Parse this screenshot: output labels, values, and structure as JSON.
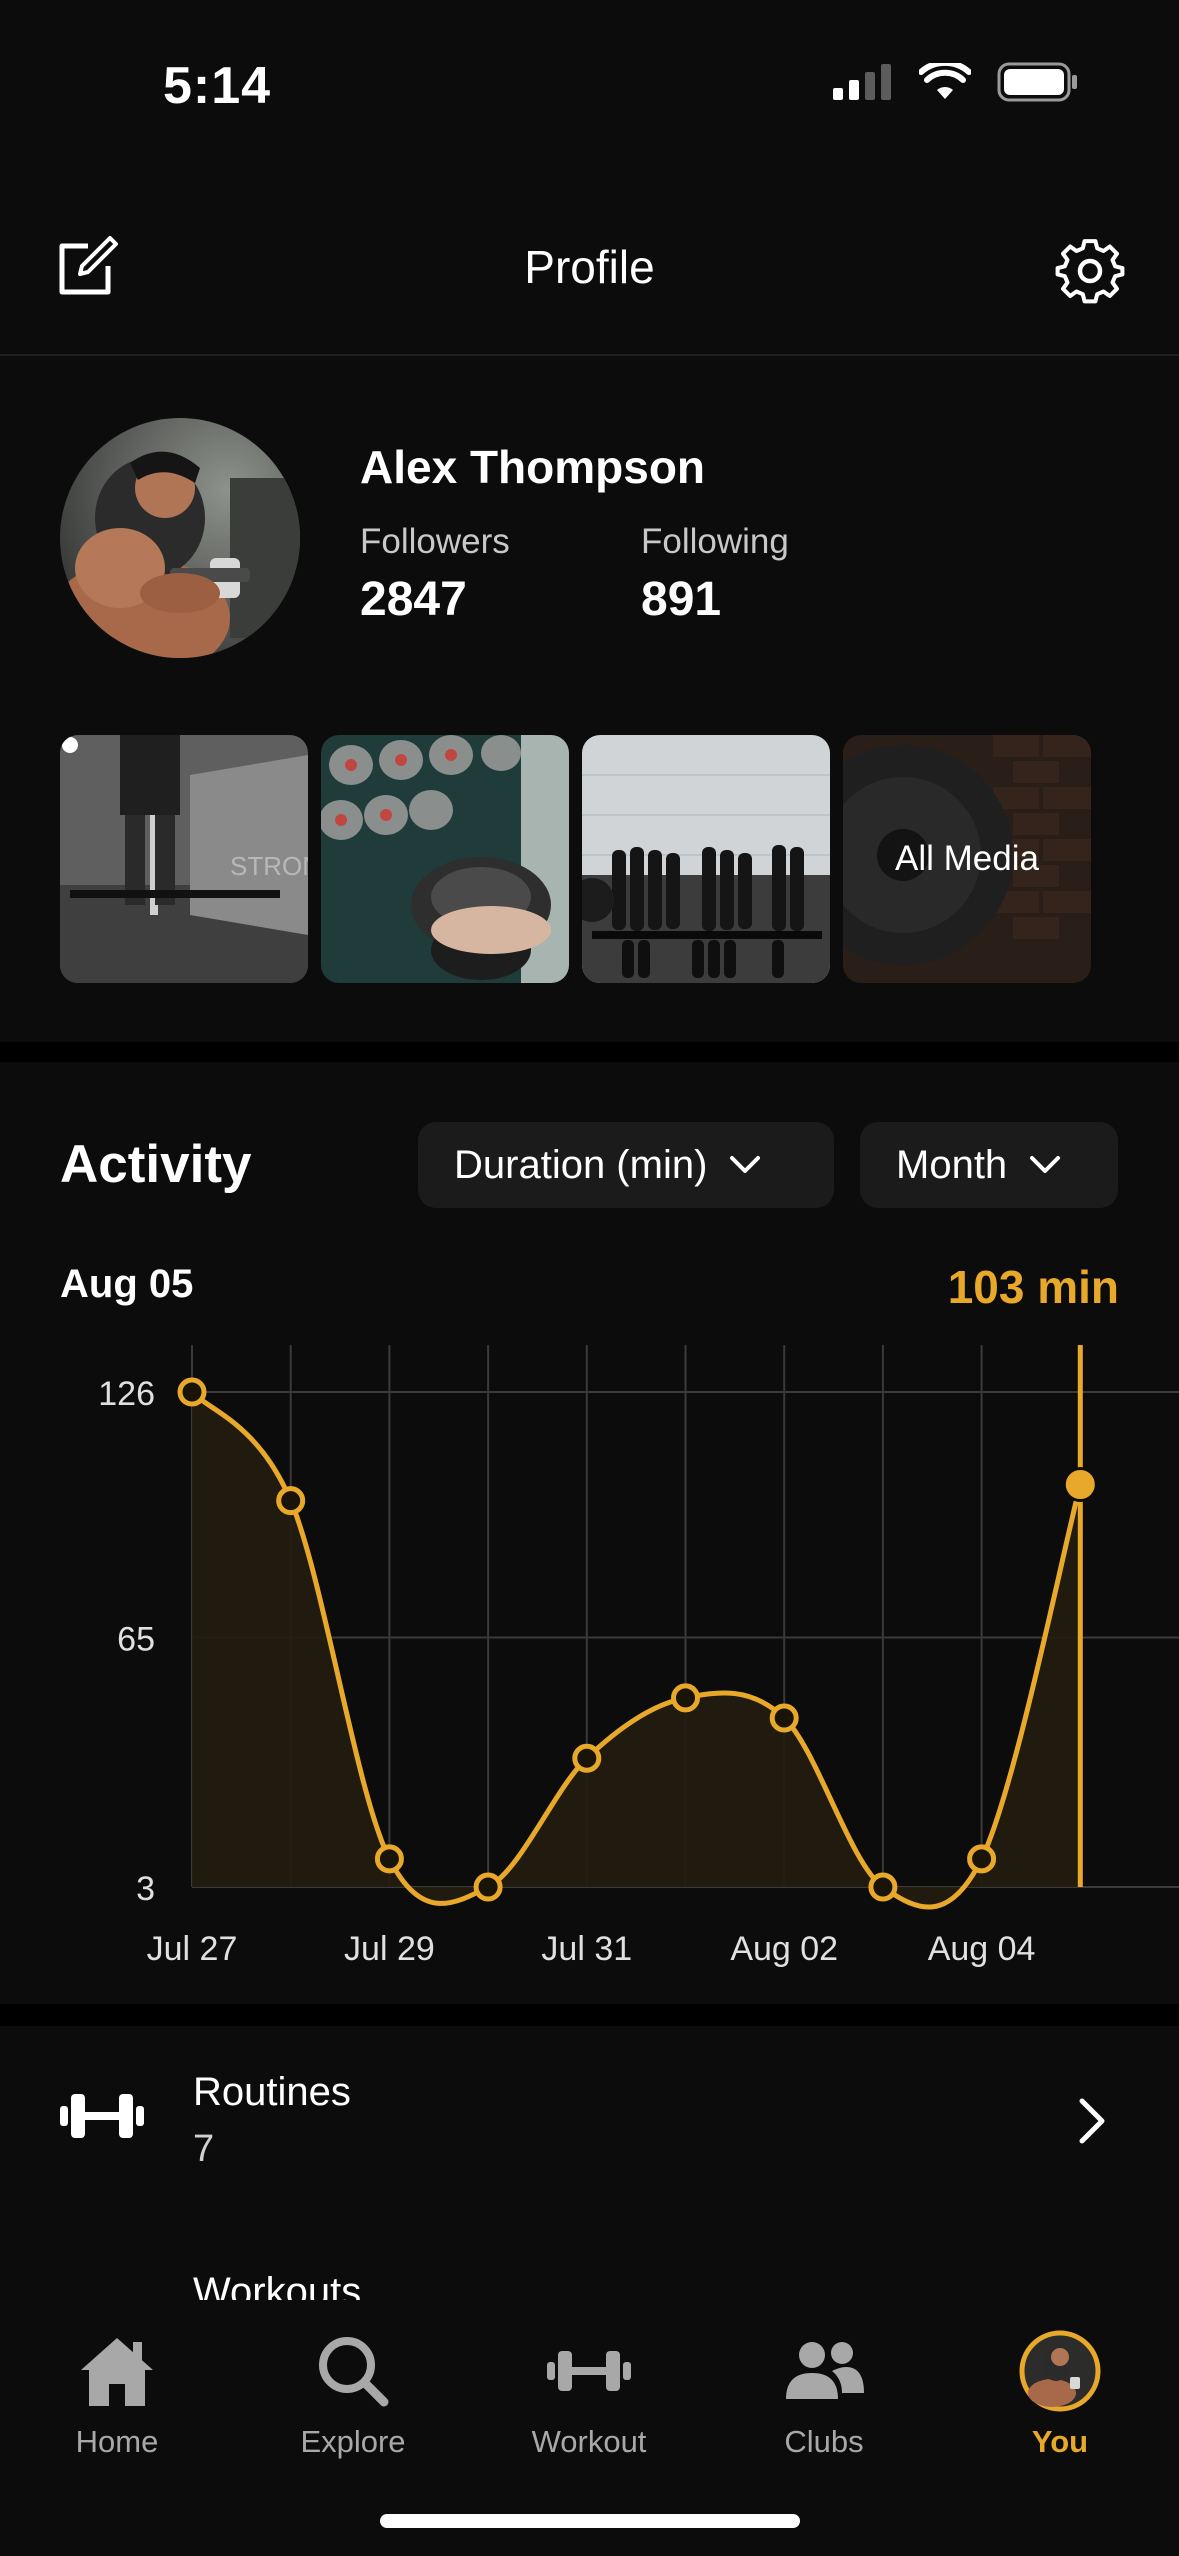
{
  "status_bar": {
    "time": "5:14"
  },
  "header": {
    "title": "Profile"
  },
  "profile": {
    "name": "Alex Thompson",
    "followers_label": "Followers",
    "followers_value": "2847",
    "following_label": "Following",
    "following_value": "891"
  },
  "media": {
    "all_media_label": "All Media"
  },
  "activity": {
    "title": "Activity",
    "metric_dropdown": "Duration (min)",
    "period_dropdown": "Month",
    "selected_date": "Aug 05",
    "selected_value": "103 min"
  },
  "chart_data": {
    "type": "line",
    "x": [
      "Jul 27",
      "Jul 28",
      "Jul 29",
      "Jul 30",
      "Jul 31",
      "Aug 01",
      "Aug 02",
      "Aug 03",
      "Aug 04",
      "Aug 05"
    ],
    "values": [
      126,
      99,
      10,
      3,
      35,
      50,
      45,
      3,
      10,
      103
    ],
    "x_tick_labels": [
      "Jul 27",
      "Jul 29",
      "Jul 31",
      "Aug 02",
      "Aug 04"
    ],
    "y_tick_labels": [
      "126",
      "65",
      "3"
    ],
    "ylim": [
      3,
      126
    ],
    "grid": true,
    "line_color": "#e8a92a",
    "fill_color": "#241c10",
    "selected_index": 9
  },
  "routines": {
    "title": "Routines",
    "count": "7"
  },
  "workouts": {
    "title": "Workouts"
  },
  "tabbar": {
    "home": "Home",
    "explore": "Explore",
    "workout": "Workout",
    "clubs": "Clubs",
    "you": "You",
    "active_color": "#e8a92a"
  }
}
